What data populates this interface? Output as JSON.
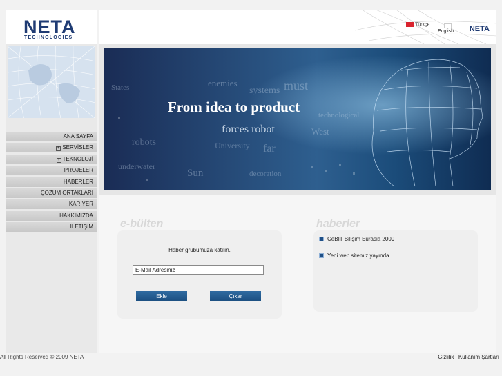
{
  "brand": {
    "name": "NETA",
    "sub": "TECHNOLOGIES",
    "small": "NETA"
  },
  "languages": [
    {
      "label": "Türkçe"
    },
    {
      "label": "English"
    }
  ],
  "nav": [
    {
      "label": "ANA SAYFA",
      "expand": false
    },
    {
      "label": "SERVİSLER",
      "expand": true
    },
    {
      "label": "TEKNOLOJİ",
      "expand": true
    },
    {
      "label": "PROJELER",
      "expand": false
    },
    {
      "label": "HABERLER",
      "expand": false
    },
    {
      "label": "ÇÖZÜM ORTAKLARI",
      "expand": false
    },
    {
      "label": "KARİYER",
      "expand": false
    },
    {
      "label": "HAKKIMIZDA",
      "expand": false
    },
    {
      "label": "İLETİŞİM",
      "expand": false
    }
  ],
  "banner": {
    "headline": "From idea to product"
  },
  "ebulten": {
    "title": "e-bülten",
    "prompt": "Haber grubumuza katılın.",
    "email_value": "E-Mail Adresiniz",
    "add_label": "Ekle",
    "remove_label": "Çıkar"
  },
  "haberler": {
    "title": "haberler",
    "items": [
      "CeBIT Bilişim Eurasia 2009",
      "Yeni web sitemiz yayında"
    ]
  },
  "footer": {
    "copyright": "All Rights Reserved © 2009 NETA",
    "privacy": "Gizlilik",
    "separator": "|",
    "terms": "Kullanım Şartları"
  },
  "colors": {
    "brand_blue": "#1f3b73",
    "button_blue": "#2f6aa0"
  }
}
